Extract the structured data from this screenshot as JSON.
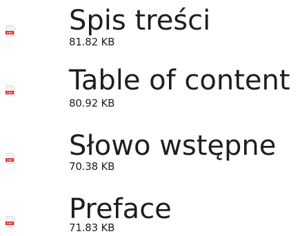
{
  "files": [
    {
      "title": "Spis treści",
      "size": "81.82 KB",
      "icon": "pdf-icon"
    },
    {
      "title": "Table of content",
      "size": "80.92 KB",
      "icon": "pdf-icon"
    },
    {
      "title": "Słowo wstępne",
      "size": "70.38 KB",
      "icon": "pdf-icon"
    },
    {
      "title": "Preface",
      "size": "71.83 KB",
      "icon": "pdf-icon"
    }
  ],
  "colors": {
    "pdf_badge": "#d9231f",
    "page": "#f3f3f3",
    "text": "#1e1e1e"
  }
}
